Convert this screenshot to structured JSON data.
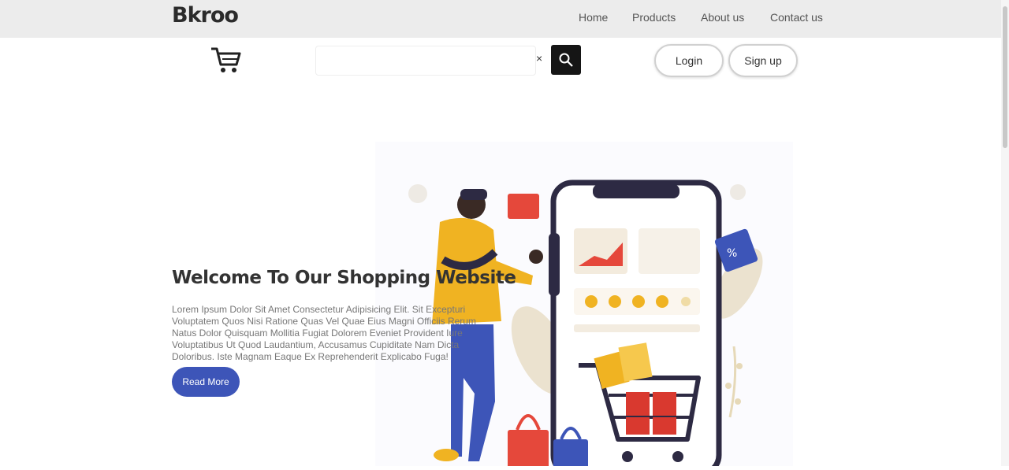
{
  "brand": {
    "logo": "Bkroo"
  },
  "nav": {
    "items": [
      {
        "label": "Home"
      },
      {
        "label": "Products"
      },
      {
        "label": "About us"
      },
      {
        "label": "Contact us"
      }
    ]
  },
  "search": {
    "value": "",
    "placeholder": "",
    "clear_glyph": "×"
  },
  "auth": {
    "login_label": "Login",
    "signup_label": "Sign up"
  },
  "hero": {
    "title": "Welcome To Our Shopping Website",
    "paragraph": "Lorem Ipsum Dolor Sit Amet Consectetur Adipisicing Elit. Sit Excepturi Voluptatem Quos Nisi Ratione Quas Vel Quae Eius Magni Officiis Rerum Natus Dolor Quisquam Mollitia Fugiat Dolorem Eveniet Provident Iure Voluptatibus Ut Quod Laudantium, Accusamus Cupiditate Nam Dicta Doloribus. Iste Magnam Eaque Ex Reprehenderit Explicabo Fuga!",
    "cta_label": "Read More"
  },
  "icons": {
    "cart": "shopping-cart-icon",
    "search": "search-icon",
    "clear": "close-icon"
  },
  "colors": {
    "topbar": "#ececec",
    "accent": "#3d55b8",
    "search_button": "#151515",
    "text_dark": "#333333"
  }
}
